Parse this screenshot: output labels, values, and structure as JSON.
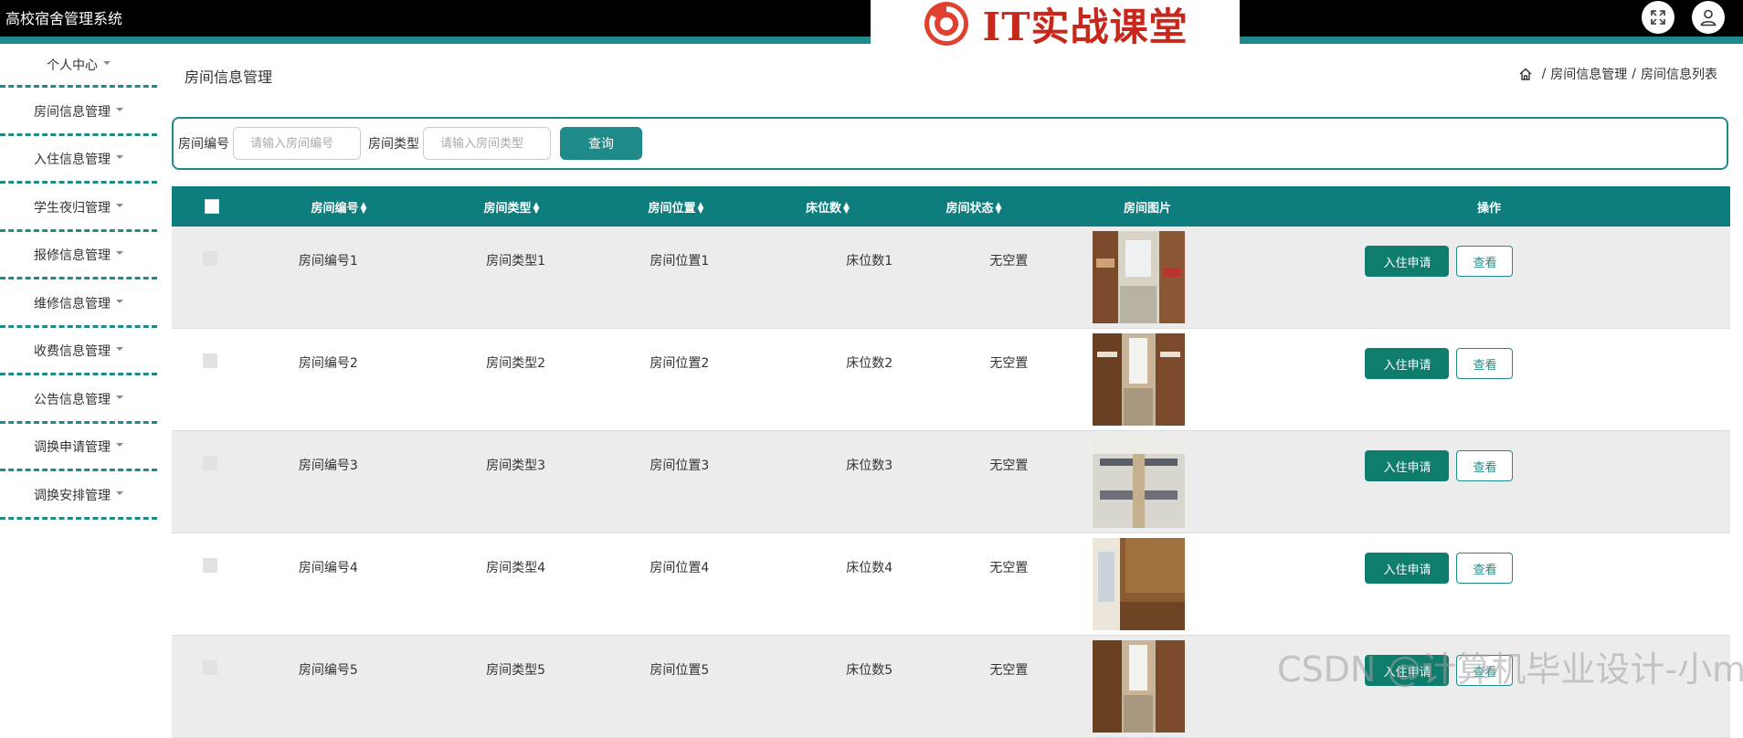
{
  "app": {
    "title": "高校宿舍管理系统"
  },
  "brand": {
    "text": "IT实战课堂"
  },
  "header": {
    "fullscreen_icon": "fullscreen-icon",
    "user_icon": "user-icon"
  },
  "sidebar": {
    "items": [
      {
        "label": "个人中心"
      },
      {
        "label": "房间信息管理"
      },
      {
        "label": "入住信息管理"
      },
      {
        "label": "学生夜归管理"
      },
      {
        "label": "报修信息管理"
      },
      {
        "label": "维修信息管理"
      },
      {
        "label": "收费信息管理"
      },
      {
        "label": "公告信息管理"
      },
      {
        "label": "调换申请管理"
      },
      {
        "label": "调换安排管理"
      }
    ]
  },
  "page": {
    "title": "房间信息管理",
    "breadcrumb": [
      "房间信息管理",
      "房间信息列表"
    ]
  },
  "search": {
    "room_no_label": "房间编号",
    "room_no_placeholder": "请输入房间编号",
    "room_type_label": "房间类型",
    "room_type_placeholder": "请输入房间类型",
    "query_label": "查询"
  },
  "table": {
    "headers": [
      "房间编号",
      "房间类型",
      "房间位置",
      "床位数",
      "房间状态",
      "房间图片",
      "操作"
    ],
    "rows": [
      {
        "room_no": "房间编号1",
        "type": "房间类型1",
        "location": "房间位置1",
        "beds": "床位数1",
        "status": "无空置"
      },
      {
        "room_no": "房间编号2",
        "type": "房间类型2",
        "location": "房间位置2",
        "beds": "床位数2",
        "status": "无空置"
      },
      {
        "room_no": "房间编号3",
        "type": "房间类型3",
        "location": "房间位置3",
        "beds": "床位数3",
        "status": "无空置"
      },
      {
        "room_no": "房间编号4",
        "type": "房间类型4",
        "location": "房间位置4",
        "beds": "床位数4",
        "status": "无空置"
      },
      {
        "room_no": "房间编号5",
        "type": "房间类型5",
        "location": "房间位置5",
        "beds": "床位数5",
        "status": "无空置"
      }
    ],
    "apply_label": "入住申请",
    "view_label": "查看"
  },
  "watermark": "CSDN @计算机毕业设计-小ma",
  "colors": {
    "primary": "#1f8a8a",
    "header_bg": "#0e7d7d",
    "topbar": "#000000"
  }
}
